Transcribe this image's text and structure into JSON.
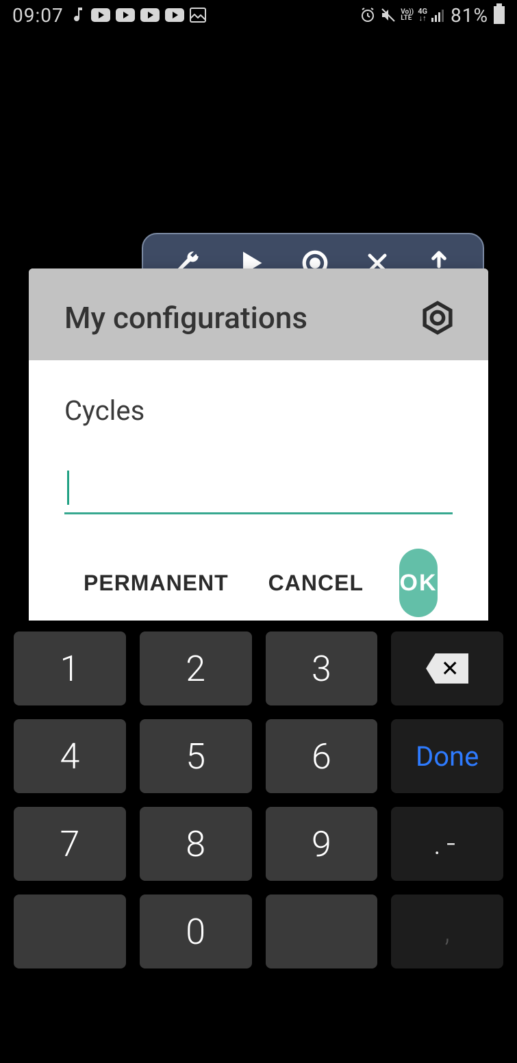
{
  "status": {
    "time": "09:07",
    "battery_pct": "81%"
  },
  "toolbar": {
    "icons": [
      "wrench-icon",
      "play-icon",
      "record-icon",
      "close-icon",
      "share-icon"
    ]
  },
  "modal": {
    "title": "My configurations",
    "field_label": "Cycles",
    "input_value": "",
    "actions": {
      "permanent": "PERMANENT",
      "cancel": "CANCEL",
      "ok": "OK"
    }
  },
  "keypad": {
    "rows": [
      [
        "1",
        "2",
        "3"
      ],
      [
        "4",
        "5",
        "6"
      ],
      [
        "7",
        "8",
        "9"
      ],
      [
        "",
        "0",
        ""
      ]
    ],
    "done": "Done",
    "punct": ".-",
    "comma": ","
  }
}
